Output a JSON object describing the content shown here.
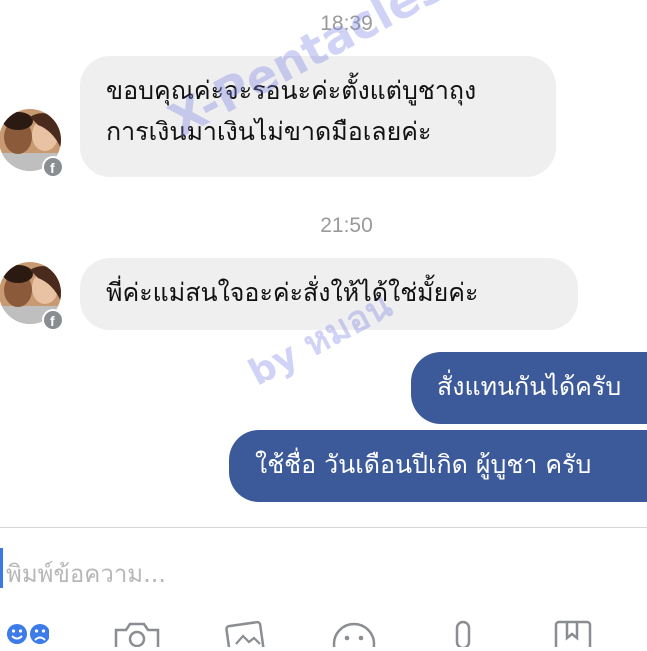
{
  "messages": {
    "timestamp1": "18:39",
    "incoming1_line1": "ขอบคุณค่ะจะรอนะค่ะตั้งแต่บูชาถุง",
    "incoming1_line2": "การเงินมาเงินไม่ขาดมือเลยค่ะ",
    "timestamp2": "21:50",
    "incoming2": "พี่ค่ะแม่สนใจอะค่ะสั่งให้ได้ใช่มั้ยค่ะ",
    "outgoing1": "สั่งแทนกันได้ครับ",
    "outgoing2": "ใช้ชื่อ วันเดือนปีเกิด ผู้บูชา ครับ"
  },
  "watermark": {
    "line1": "X-Pentacles",
    "line2": "by หมอน"
  },
  "composer": {
    "placeholder": "พิมพ์ข้อความ..."
  },
  "toolbar": {
    "icons": [
      "emoji-icon",
      "camera-icon",
      "gallery-icon",
      "smiley-icon",
      "microphone-icon",
      "bookmark-icon"
    ]
  },
  "colors": {
    "outgoing_bubble": "#3c5a99",
    "incoming_bubble": "#efefef",
    "timestamp": "#9a9a9a"
  }
}
